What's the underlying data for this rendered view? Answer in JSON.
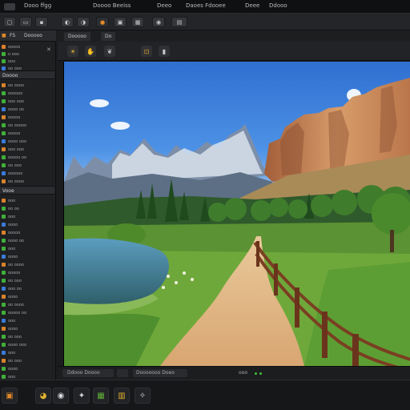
{
  "menubar": {
    "items": [
      "Dooo ffgg",
      "Doooo Beeiss",
      "Deeo",
      "Daoes Fdooee",
      "Deee",
      "Ddooo"
    ]
  },
  "toolbar": {
    "btn_labels": [
      "",
      "",
      "",
      "",
      "",
      "",
      "",
      "",
      "",
      ""
    ]
  },
  "left_panel": {
    "tab1": "FS",
    "tab2": "Dooooo",
    "rows_top": [
      "ooooo",
      "o ooo",
      "ooo",
      "oo ooo"
    ],
    "section1": "Doooo",
    "rows_mid": [
      "oo oooo",
      "oooooo",
      "ooo ooo",
      "oooo oo",
      "ooooo",
      "oo ooooo",
      "ooooo",
      "oooo ooo",
      "ooo ooo",
      "ooooo oo",
      "oo ooo",
      "oooooo",
      "oo oooo"
    ],
    "section2": "Vooe",
    "rows_bottom": [
      "ooo",
      "oo oo",
      "ooo",
      "oooo",
      "ooooo",
      "oooo oo",
      "ooo",
      "oooo",
      "oo oooo",
      "ooooo",
      "oo ooo",
      "ooo oo",
      "oooo",
      "oo oooo",
      "ooooo oo",
      "ooo",
      "oooo",
      "oo ooo",
      "oooo ooo",
      "ooo",
      "oo ooo",
      "oooo",
      "ooo"
    ],
    "colors": {
      "green": "#3fae3a",
      "orange": "#d9822b",
      "blue": "#3a7ad9"
    }
  },
  "viewport": {
    "tabs": [
      "Dooooo",
      "Do"
    ],
    "tools": [
      "sun-icon",
      "hand-icon",
      "leaf-icon",
      "frame-icon",
      "bookmark-icon"
    ]
  },
  "status": {
    "left_label": "Ddooo Doooo",
    "mid_label": "Dooooooo Doeo",
    "right_label": "ooo"
  },
  "dock": {
    "buttons": [
      "layers-icon",
      "sphere-icon",
      "move-icon",
      "grid-icon",
      "folder-icon",
      "star-icon"
    ]
  }
}
